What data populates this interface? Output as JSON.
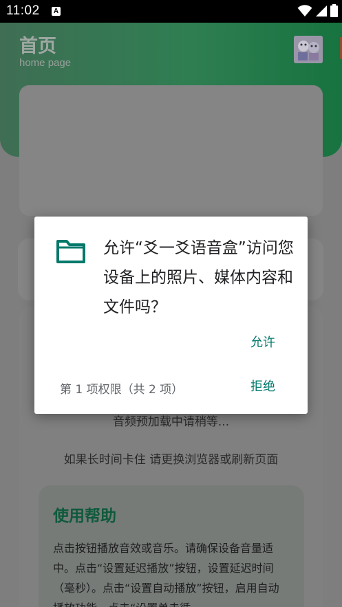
{
  "status_bar": {
    "time": "11:02",
    "notification_letter": "A"
  },
  "app": {
    "title": "首页",
    "subtitle": "home page",
    "loading_text": "音频预加载中请稍等...",
    "hint_text": "如果长时间卡住 请更换浏览器或刷新页面",
    "help": {
      "title": "使用帮助",
      "body": "点击按钮播放音效或音乐。请确保设备音量适中。点击“设置延迟播放”按钮，设置延迟时间（毫秒）。点击“设置自动播放”按钮，启用自动播放功能。点击“设置单击循"
    }
  },
  "dialog": {
    "message": "允许“爻一爻语音盒”访问您设备上的照片、媒体内容和文件吗？",
    "allow_label": "允许",
    "deny_label": "拒绝",
    "counter": "第 1 项权限（共 2 项）",
    "accent_color": "#00796b"
  }
}
